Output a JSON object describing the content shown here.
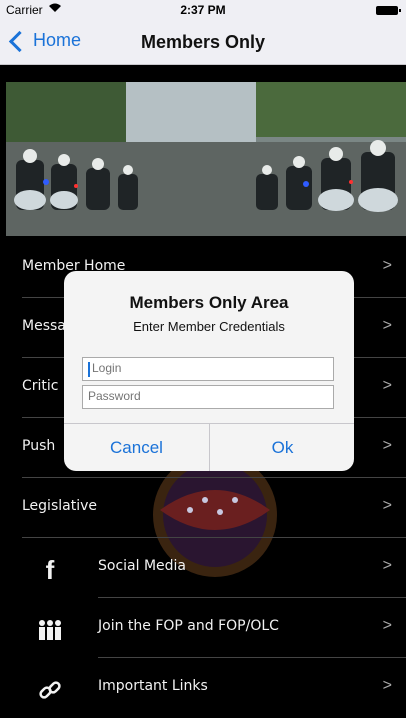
{
  "status": {
    "carrier": "Carrier",
    "time": "2:37 PM"
  },
  "nav": {
    "back_label": "Home",
    "title": "Members Only"
  },
  "menu": [
    {
      "label": "Member Home"
    },
    {
      "label": "Messa"
    },
    {
      "label": "Critic"
    },
    {
      "label": "Push"
    },
    {
      "label": "Legislative"
    },
    {
      "label": "Social Media",
      "icon": "facebook-icon"
    },
    {
      "label": "Join the FOP and FOP/OLC",
      "icon": "people-icon"
    },
    {
      "label": "Important Links",
      "icon": "link-icon"
    }
  ],
  "dialog": {
    "title": "Members Only Area",
    "subtitle": "Enter Member Credentials",
    "login_placeholder": "Login",
    "password_placeholder": "Password",
    "cancel_label": "Cancel",
    "ok_label": "Ok"
  },
  "colors": {
    "accent": "#1a72d8",
    "nav_bg": "#efeff4",
    "menu_bg": "#000000"
  }
}
